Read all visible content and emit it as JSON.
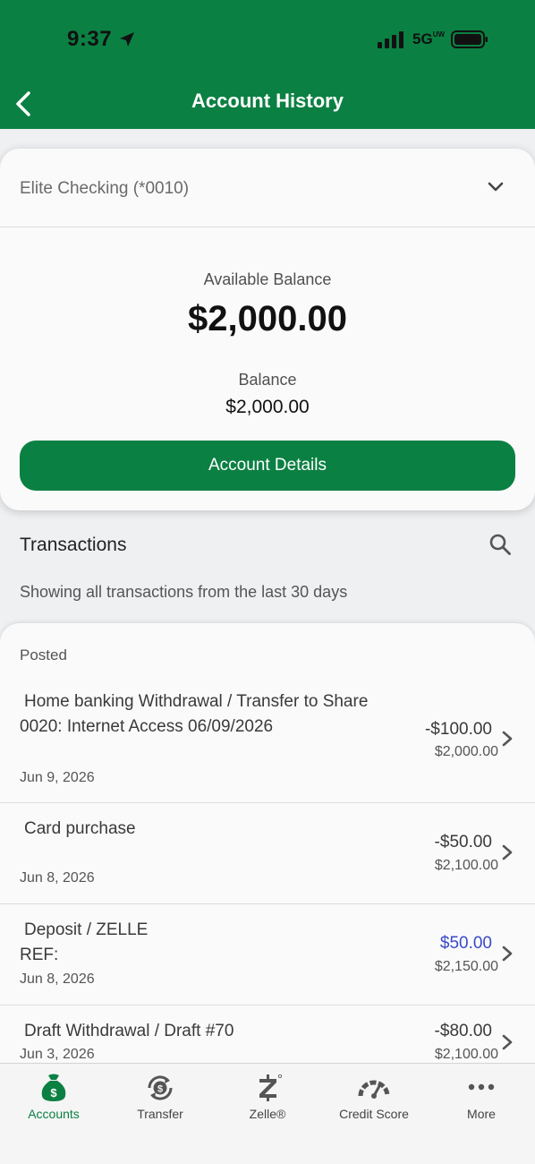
{
  "status_bar": {
    "time": "9:37",
    "network": "5G",
    "network_sup": "UW"
  },
  "header": {
    "title": "Account History"
  },
  "account": {
    "selected": "Elite Checking (*0010)",
    "available_label": "Available Balance",
    "available_value": "$2,000.00",
    "balance_label": "Balance",
    "balance_value": "$2,000.00",
    "details_button": "Account Details"
  },
  "transactions": {
    "title": "Transactions",
    "subtitle": "Showing all transactions from the last 30 days",
    "section_label": "Posted",
    "items": [
      {
        "line1": "Home banking Withdrawal / Transfer to Share",
        "line2": "0020: Internet Access 06/09/2026",
        "date": "Jun 9, 2026",
        "amount": "-$100.00",
        "running": "$2,000.00",
        "type": "debit"
      },
      {
        "line1": "Card purchase",
        "line2": "",
        "date": "Jun 8, 2026",
        "amount": "-$50.00",
        "running": "$2,100.00",
        "type": "debit"
      },
      {
        "line1": "Deposit / ZELLE",
        "line2": "REF:",
        "date": "Jun 8, 2026",
        "amount": "$50.00",
        "running": "$2,150.00",
        "type": "credit"
      },
      {
        "line1": "Draft Withdrawal / Draft #70",
        "line2": "",
        "date": "Jun 3, 2026",
        "amount": "-$80.00",
        "running": "$2,100.00",
        "type": "debit"
      }
    ]
  },
  "tabbar": {
    "items": [
      {
        "label": "Accounts",
        "icon": "money-bag-icon",
        "active": true
      },
      {
        "label": "Transfer",
        "icon": "transfer-icon",
        "active": false
      },
      {
        "label": "Zelle®",
        "icon": "zelle-icon",
        "active": false
      },
      {
        "label": "Credit Score",
        "icon": "gauge-icon",
        "active": false
      },
      {
        "label": "More",
        "icon": "more-icon",
        "active": false
      }
    ]
  },
  "colors": {
    "brand_green": "#0b8043",
    "credit_blue": "#3a49c8"
  }
}
